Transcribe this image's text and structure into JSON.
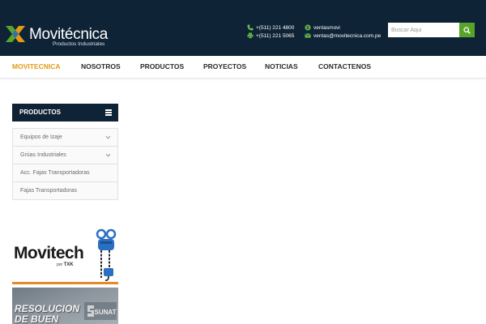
{
  "header": {
    "brand": {
      "name": "Movitécnica",
      "tagline": "Productos Industriales"
    },
    "phones": [
      "+(511) 221 4800",
      "+(511) 221 5065"
    ],
    "skype": "ventasmovi",
    "email": "ventas@movitecnica.com.pe",
    "search": {
      "placeholder": "Buscar Aqui"
    }
  },
  "nav": {
    "items": [
      {
        "label": "MOVITECNICA",
        "active": true
      },
      {
        "label": "NOSOTROS"
      },
      {
        "label": "PRODUCTOS"
      },
      {
        "label": "PROYECTOS"
      },
      {
        "label": "NOTICIAS"
      },
      {
        "label": "CONTACTENOS"
      }
    ]
  },
  "sidebar": {
    "title": "PRODUCTOS",
    "items": [
      {
        "label": "Equipos de Izaje",
        "expandable": true
      },
      {
        "label": "Grúas Industriales",
        "expandable": true
      },
      {
        "label": "Acc. Fajas Transportadoras",
        "expandable": false
      },
      {
        "label": "Fajas Transportadoras",
        "expandable": false
      }
    ]
  },
  "banners": {
    "movitech": {
      "title": "Movitech",
      "sub_prefix": "por",
      "sub_brand": "TXK"
    },
    "sunat": {
      "line1": "RESOLUCION",
      "line2": "DE BUEN",
      "logo": "SUNAT"
    }
  },
  "colors": {
    "header_bg": "#0f2336",
    "accent_orange": "#e39a16",
    "search_green": "#58a42b",
    "icon_green": "#6cc04a"
  }
}
